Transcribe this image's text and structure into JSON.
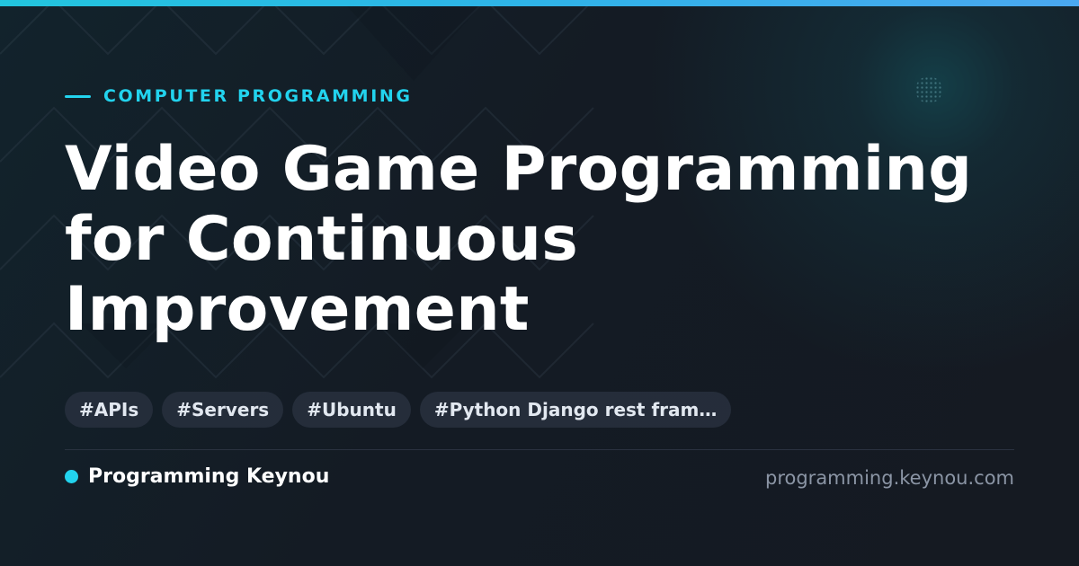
{
  "category": "COMPUTER PROGRAMMING",
  "title": "Video Game Programming for Continuous Improvement",
  "tags": [
    "#APIs",
    "#Servers",
    "#Ubuntu",
    "#Python Django rest fram…"
  ],
  "brand": {
    "name": "Programming Keynou",
    "domain": "programming.keynou.com"
  },
  "colors": {
    "accent": "#22d3ee",
    "background": "#141a23",
    "title": "#ffffff",
    "tag_background": "#28303e",
    "domain_text": "#8b95a5"
  },
  "icons": {
    "category_marker": "accent-line",
    "brand_marker": "status-dot"
  }
}
